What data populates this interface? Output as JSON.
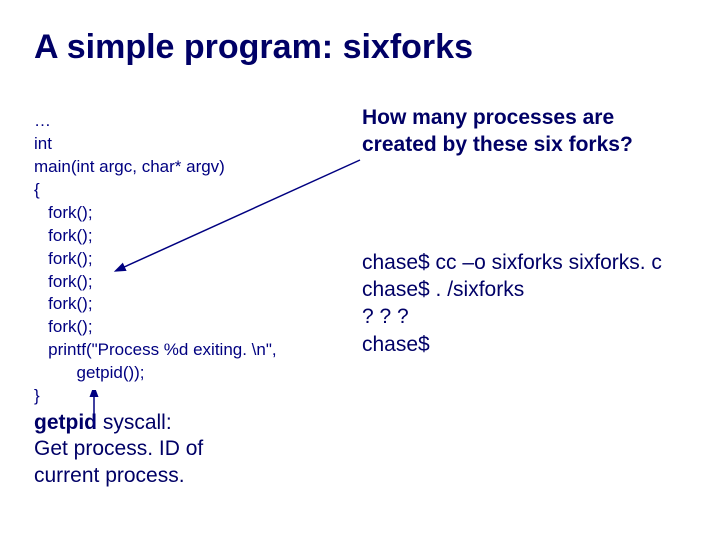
{
  "title": "A simple program: sixforks",
  "code": {
    "l0": "…",
    "l1": "int",
    "l2": "main(int argc, char* argv)",
    "l3": "{",
    "l4": "   fork();",
    "l5": "   fork();",
    "l6": "   fork();",
    "l7": "   fork();",
    "l8": "   fork();",
    "l9": "   fork();",
    "l10": "   printf(\"Process %d exiting. \\n\",",
    "l11": "         getpid());",
    "l12": "}"
  },
  "getpid": {
    "kw": "getpid",
    "rest1": " syscall:",
    "line2": "Get process. ID of",
    "line3": "current process."
  },
  "question": {
    "l1": "How many processes are",
    "l2": "created by these six forks?"
  },
  "term": {
    "t1": "chase$ cc –o sixforks sixforks. c",
    "t2": "chase$ . /sixforks",
    "t3": "? ? ?",
    "t4": "chase$"
  }
}
